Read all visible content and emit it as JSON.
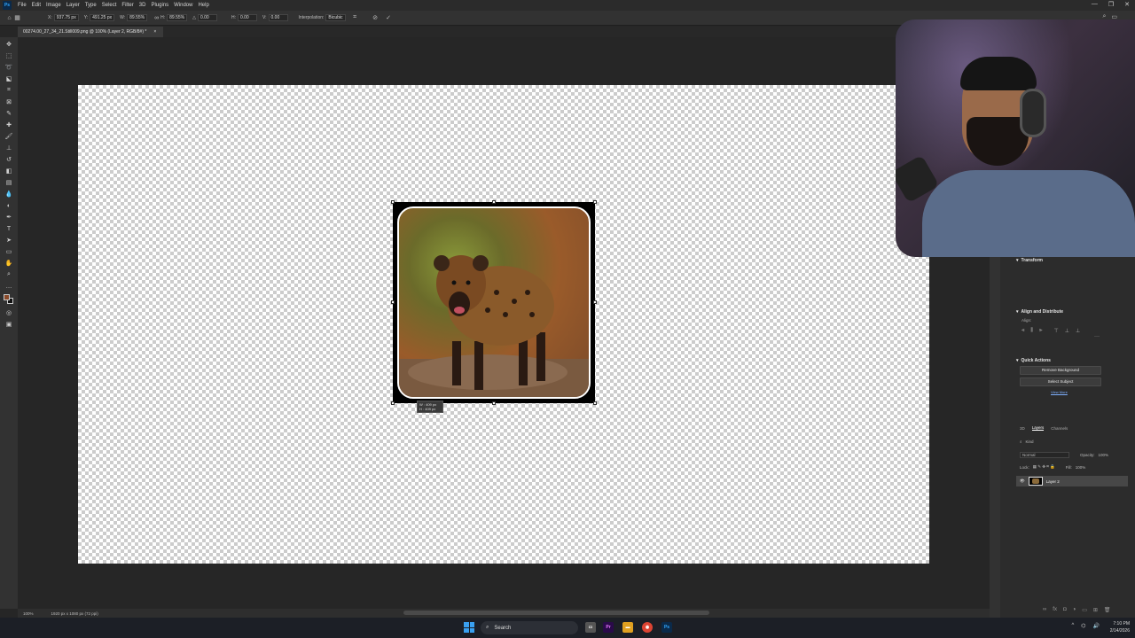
{
  "menubar": {
    "logo": "Ps",
    "items": [
      "File",
      "Edit",
      "Image",
      "Layer",
      "Type",
      "Select",
      "Filter",
      "3D",
      "Plugins",
      "Window",
      "Help"
    ]
  },
  "options": {
    "x_label": "X:",
    "x_value": "937.75 px",
    "y_label": "Y:",
    "y_value": "491.25 px",
    "w_label": "W:",
    "w_value": "89.55%",
    "h_label": "H:",
    "h_value": "89.55%",
    "angle_label": "△",
    "angle_value": "0.00",
    "hskew_label": "H:",
    "hskew_value": "0.00",
    "vskew_label": "V:",
    "vskew_value": "0.00",
    "interp_label": "Interpolation:",
    "interp_value": "Bicubic"
  },
  "document": {
    "tab_title": "00274.00_27_34_21.Still009.png @ 100% (Layer 2, RGB/8#) *",
    "tab_close": "×"
  },
  "transform_tooltip": {
    "w": "W : 409 px",
    "h": "H : 409 px"
  },
  "status": {
    "zoom": "100%",
    "doc_size": "1920 px x 1080 px (72 ppi)"
  },
  "properties": {
    "transform_title": "Transform",
    "align_title": "Align and Distribute",
    "align_label": "Align:",
    "quick_actions_title": "Quick Actions",
    "remove_bg": "Remove Background",
    "select_subject": "Select Subject",
    "view_more": "View More"
  },
  "layers_panel": {
    "tabs": [
      "3D",
      "Layers",
      "Channels"
    ],
    "active_tab": "Layers",
    "kind_placeholder": "Kind",
    "blend_mode": "Normal",
    "opacity_label": "Opacity:",
    "opacity_value": "100%",
    "lock_label": "Lock:",
    "fill_label": "Fill:",
    "fill_value": "100%",
    "layer_name": "Layer 2"
  },
  "taskbar": {
    "search_label": "Search",
    "time": "7:10 PM",
    "date": "2/14/2026",
    "accent": "#3aa0f0"
  }
}
